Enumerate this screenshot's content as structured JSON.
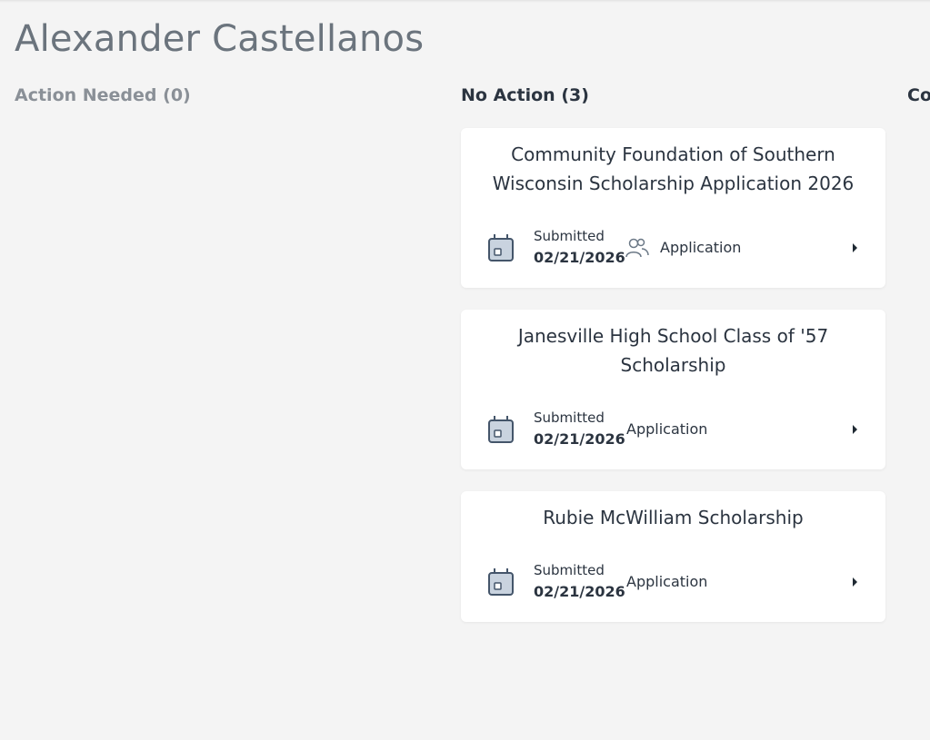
{
  "page": {
    "title": "Alexander Castellanos"
  },
  "columns": {
    "action_needed": "Action Needed (0)",
    "no_action": "No Action (3)",
    "complete_partial": "Co"
  },
  "cards": [
    {
      "title": "Community Foundation of Southern Wisconsin Scholarship Application 2026",
      "status_label": "Submitted",
      "date": "02/21/2026",
      "type": "Application",
      "icons": [
        "calendar-icon",
        "people-icon",
        "caret-right-icon"
      ]
    },
    {
      "title": "Janesville High School Class of '57 Scholarship",
      "status_label": "Submitted",
      "date": "02/21/2026",
      "type": "Application",
      "icons": [
        "calendar-icon",
        "caret-right-icon"
      ]
    },
    {
      "title": "Rubie McWilliam Scholarship",
      "status_label": "Submitted",
      "date": "02/21/2026",
      "type": "Application",
      "icons": [
        "calendar-icon",
        "caret-right-icon"
      ]
    }
  ],
  "colors": {
    "background": "#f4f4f4",
    "card": "#ffffff",
    "text": "#2b3440",
    "muted": "#6b747d",
    "icon_fill": "#c9d3df",
    "icon_stroke": "#44556a"
  }
}
